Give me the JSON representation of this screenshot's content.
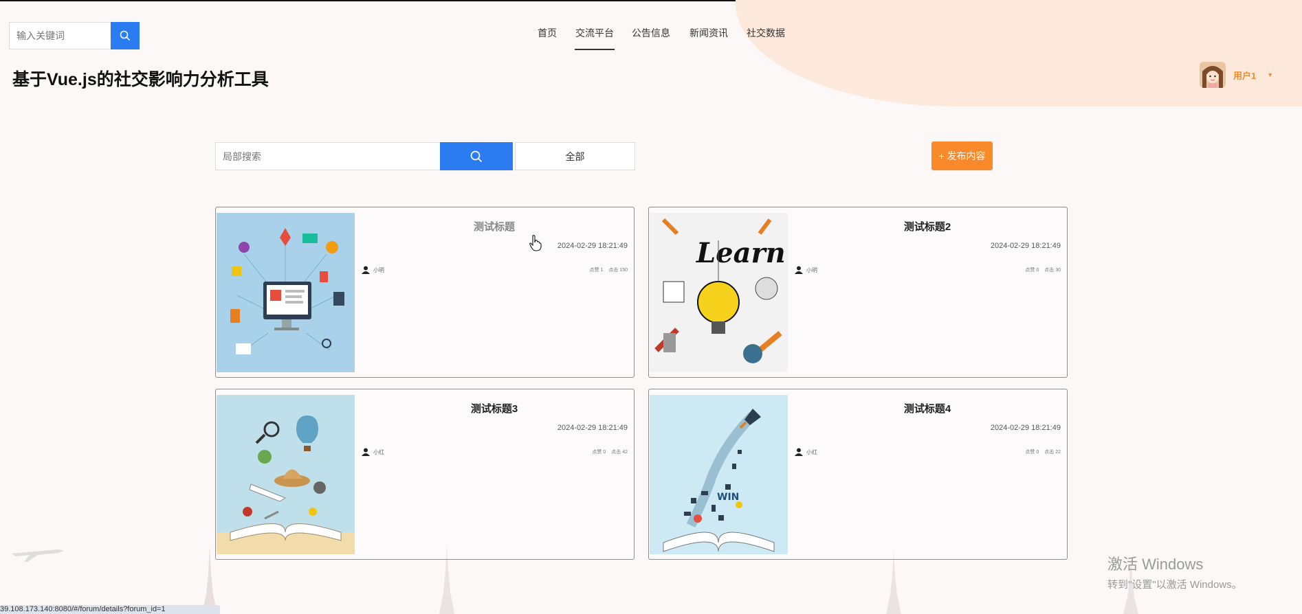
{
  "header": {
    "search_placeholder": "输入关键词",
    "site_title": "基于Vue.js的社交影响力分析工具",
    "nav": [
      {
        "label": "首页",
        "active": false
      },
      {
        "label": "交流平台",
        "active": true
      },
      {
        "label": "公告信息",
        "active": false
      },
      {
        "label": "新闻资讯",
        "active": false
      },
      {
        "label": "社交数据",
        "active": false
      }
    ],
    "user_name": "用户1"
  },
  "toolbar": {
    "local_search_placeholder": "局部搜索",
    "all_label": "全部",
    "publish_label": "+ 发布内容"
  },
  "posts": [
    {
      "title": "测试标题",
      "date": "2024-02-29 18:21:49",
      "author": "小明",
      "likes": "点赞 1",
      "clicks": "点击 150",
      "image": "computer-marketing-illustration"
    },
    {
      "title": "测试标题2",
      "date": "2024-02-29 18:21:49",
      "author": "小明",
      "likes": "点赞 0",
      "clicks": "点击 30",
      "image": "learn-lightbulb-illustration"
    },
    {
      "title": "测试标题3",
      "date": "2024-02-29 18:21:49",
      "author": "小红",
      "likes": "点赞 0",
      "clicks": "点击 42",
      "image": "open-book-travel-illustration"
    },
    {
      "title": "测试标题4",
      "date": "2024-02-29 18:21:49",
      "author": "小红",
      "likes": "点赞 0",
      "clicks": "点击 22",
      "image": "open-book-rocket-illustration"
    }
  ],
  "watermark": {
    "line1": "激活 Windows",
    "line2": "转到\"设置\"以激活 Windows。"
  },
  "status_url": "39.108.173.140:8080/#/forum/details?forum_id=1",
  "colors": {
    "primary_blue": "#2b7cf0",
    "accent_orange": "#f98a2b",
    "user_orange": "#f08a2c",
    "header_blob": "#fde9db"
  }
}
